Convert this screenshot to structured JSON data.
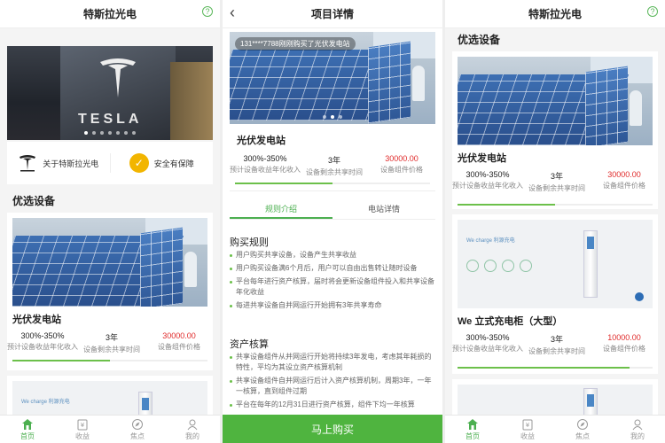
{
  "app": {
    "title": "特斯拉光电",
    "help_icon": "question-circle-icon"
  },
  "banner": {
    "brand_word": "TESLA",
    "slides": 7,
    "active_slide": 1
  },
  "features": [
    {
      "icon": "tesla-logo-icon",
      "label": "关于特斯拉光电"
    },
    {
      "icon": "shield-check-icon",
      "label": "安全有保障"
    }
  ],
  "section": {
    "title": "优选设备"
  },
  "products": [
    {
      "name": "光伏发电站",
      "image": "solar-panels-photo",
      "yield": "300%-350%",
      "yield_label": "预计设备收益年化收入",
      "term": "3年",
      "term_label": "设备剩余共享时间",
      "price": "30000.00",
      "price_label": "设备组件价格",
      "progress": 0.5
    },
    {
      "name": "We 立式充电柜（大型）",
      "image": "ev-charger-photo",
      "brand_text": "We charge 利源充电",
      "yield": "300%-350%",
      "yield_label": "预计设备收益年化收入",
      "term": "3年",
      "term_label": "设备剩余共享时间",
      "price": "10000.00",
      "price_label": "设备组件价格",
      "progress": 0.88
    }
  ],
  "tabbar": [
    {
      "icon": "home-icon",
      "label": "首页",
      "active": true
    },
    {
      "icon": "wallet-icon",
      "label": "收益",
      "active": false
    },
    {
      "icon": "compass-icon",
      "label": "焦点",
      "active": false
    },
    {
      "icon": "user-icon",
      "label": "我的",
      "active": false
    }
  ],
  "detail": {
    "title": "项目详情",
    "back_icon": "chevron-left-icon",
    "toast": "131****7788刚刚购买了光伏发电站",
    "product_name": "光伏发电站",
    "yield": "300%-350%",
    "yield_label": "预计设备收益年化收入",
    "term": "3年",
    "term_label": "设备剩余共享时间",
    "price": "30000.00",
    "price_label": "设备组件价格",
    "progress": 0.5,
    "tabs": [
      "规则介绍",
      "电站详情"
    ],
    "active_tab": 0,
    "rules_title": "购买规则",
    "rules": [
      "用户购买共享设备，设备产生共享收益",
      "用户购买设备满6个月后，用户可以自由出售转让随时设备",
      "平台每年进行资产核算，届时将会更新设备组件投入和共享设备年化收益",
      "每进共享设备自并网运行开始拥有3年共享寿命"
    ],
    "assets_title": "资产核算",
    "assets": [
      "共享设备组件从并网运行开始将持续3年发电，考虑其年耗损的特性，平均为其设立资产核算机制",
      "共享设备组件自并网运行后计入资产核算机制，周期3年，一年一核算，直到组件过期",
      "平台在每年的12月31日进行资产核算，组件下均一年核算"
    ],
    "buy_label": "马上购买"
  },
  "colors": {
    "accent": "#4caf50",
    "price": "#e02b2b",
    "buy_button": "#4fb43f",
    "shield": "#f2b500"
  }
}
